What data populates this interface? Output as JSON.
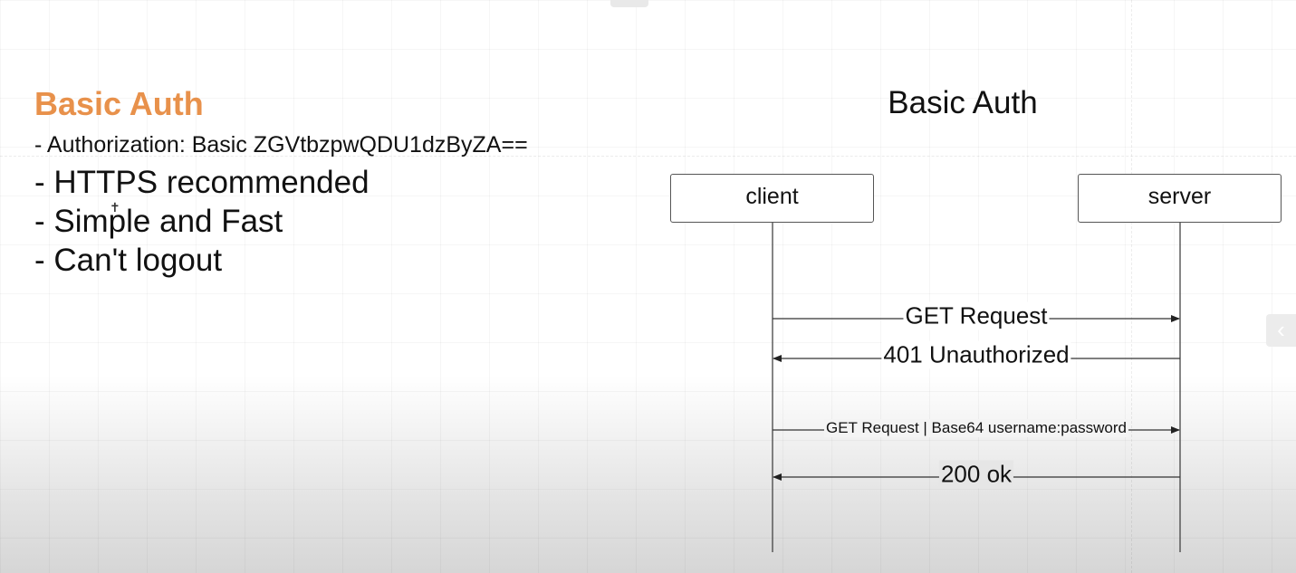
{
  "slide": {
    "left_title": "Basic Auth",
    "bullets": [
      {
        "prefix": "-",
        "text": "Authorization: Basic ZGVtbzpwQDU1dzByZA=="
      },
      {
        "prefix": "-",
        "text": "HTTPS recommended"
      },
      {
        "prefix": "-",
        "text": "Simple and Fast"
      },
      {
        "prefix": "-",
        "text": "Can't logout"
      }
    ]
  },
  "diagram": {
    "title": "Basic Auth",
    "participants": {
      "client": "client",
      "server": "server"
    },
    "messages": [
      {
        "from": "client",
        "to": "server",
        "label": "GET Request"
      },
      {
        "from": "server",
        "to": "client",
        "label": "401 Unauthorized"
      },
      {
        "from": "client",
        "to": "server",
        "label": "GET Request | Base64 username:password"
      },
      {
        "from": "server",
        "to": "client",
        "label": "200 ok"
      }
    ]
  },
  "colors": {
    "title_accent": "#e8914b",
    "line": "#333333"
  },
  "icons": {
    "side_handle": "chevron-left-icon",
    "cursor": "move-cursor-icon"
  }
}
